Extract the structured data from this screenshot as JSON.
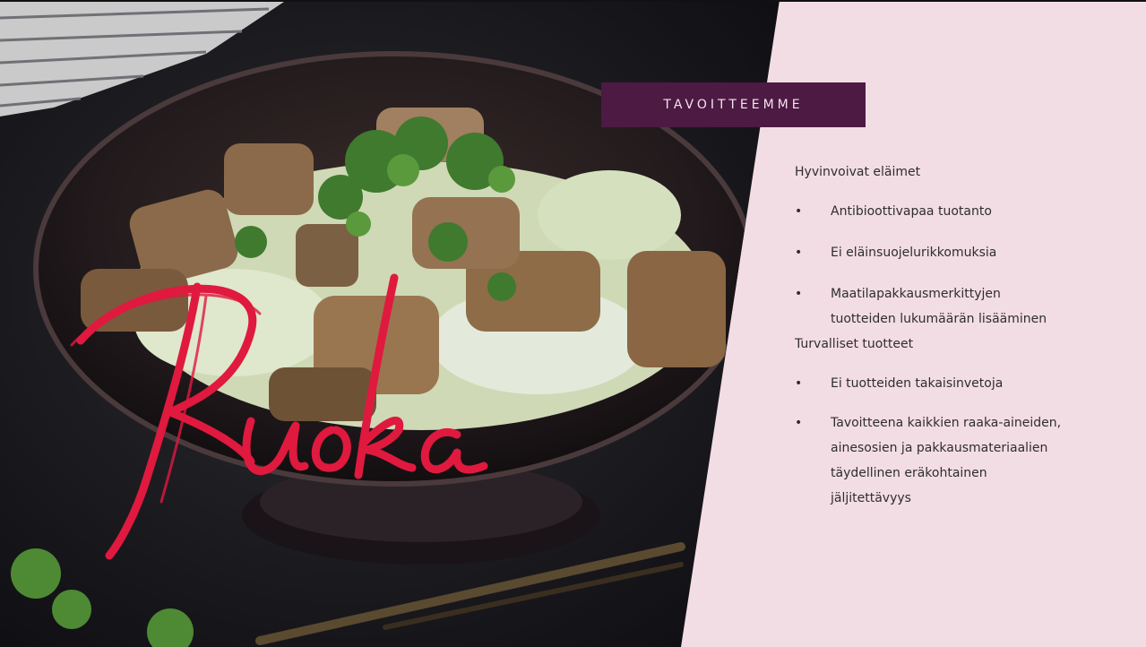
{
  "slide": {
    "header": "TAVOITTEEMME",
    "script_title": "Ruoka",
    "sections": [
      {
        "title": "Hyvinvoivat eläimet",
        "bullets": [
          "Antibioottivapaa tuotanto",
          "Ei eläinsuojelurikkomuksia",
          "Maatilapakkausmerkittyjen tuotteiden lukumäärän lisääminen"
        ]
      },
      {
        "title": "Turvalliset tuotteet",
        "bullets": [
          "Ei tuotteiden takaisinvetoja",
          "Tavoitteena kaikkien raaka-aineiden, ainesosien ja pakkausmateriaalien täydellinen eräkohtainen jäljitettävyys"
        ]
      }
    ],
    "bullet_glyph": "•"
  },
  "colors": {
    "panel_background": "#f3dde4",
    "header_box": "#4d1a44",
    "script_title": "#e0193f",
    "body_text": "#2e2e2e"
  }
}
